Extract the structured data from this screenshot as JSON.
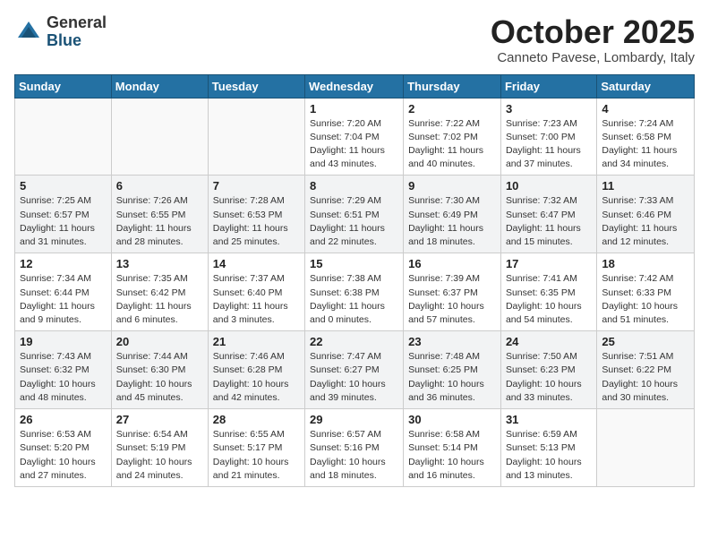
{
  "header": {
    "logo_general": "General",
    "logo_blue": "Blue",
    "month": "October 2025",
    "location": "Canneto Pavese, Lombardy, Italy"
  },
  "weekdays": [
    "Sunday",
    "Monday",
    "Tuesday",
    "Wednesday",
    "Thursday",
    "Friday",
    "Saturday"
  ],
  "weeks": [
    [
      {
        "day": "",
        "info": ""
      },
      {
        "day": "",
        "info": ""
      },
      {
        "day": "",
        "info": ""
      },
      {
        "day": "1",
        "info": "Sunrise: 7:20 AM\nSunset: 7:04 PM\nDaylight: 11 hours and 43 minutes."
      },
      {
        "day": "2",
        "info": "Sunrise: 7:22 AM\nSunset: 7:02 PM\nDaylight: 11 hours and 40 minutes."
      },
      {
        "day": "3",
        "info": "Sunrise: 7:23 AM\nSunset: 7:00 PM\nDaylight: 11 hours and 37 minutes."
      },
      {
        "day": "4",
        "info": "Sunrise: 7:24 AM\nSunset: 6:58 PM\nDaylight: 11 hours and 34 minutes."
      }
    ],
    [
      {
        "day": "5",
        "info": "Sunrise: 7:25 AM\nSunset: 6:57 PM\nDaylight: 11 hours and 31 minutes."
      },
      {
        "day": "6",
        "info": "Sunrise: 7:26 AM\nSunset: 6:55 PM\nDaylight: 11 hours and 28 minutes."
      },
      {
        "day": "7",
        "info": "Sunrise: 7:28 AM\nSunset: 6:53 PM\nDaylight: 11 hours and 25 minutes."
      },
      {
        "day": "8",
        "info": "Sunrise: 7:29 AM\nSunset: 6:51 PM\nDaylight: 11 hours and 22 minutes."
      },
      {
        "day": "9",
        "info": "Sunrise: 7:30 AM\nSunset: 6:49 PM\nDaylight: 11 hours and 18 minutes."
      },
      {
        "day": "10",
        "info": "Sunrise: 7:32 AM\nSunset: 6:47 PM\nDaylight: 11 hours and 15 minutes."
      },
      {
        "day": "11",
        "info": "Sunrise: 7:33 AM\nSunset: 6:46 PM\nDaylight: 11 hours and 12 minutes."
      }
    ],
    [
      {
        "day": "12",
        "info": "Sunrise: 7:34 AM\nSunset: 6:44 PM\nDaylight: 11 hours and 9 minutes."
      },
      {
        "day": "13",
        "info": "Sunrise: 7:35 AM\nSunset: 6:42 PM\nDaylight: 11 hours and 6 minutes."
      },
      {
        "day": "14",
        "info": "Sunrise: 7:37 AM\nSunset: 6:40 PM\nDaylight: 11 hours and 3 minutes."
      },
      {
        "day": "15",
        "info": "Sunrise: 7:38 AM\nSunset: 6:38 PM\nDaylight: 11 hours and 0 minutes."
      },
      {
        "day": "16",
        "info": "Sunrise: 7:39 AM\nSunset: 6:37 PM\nDaylight: 10 hours and 57 minutes."
      },
      {
        "day": "17",
        "info": "Sunrise: 7:41 AM\nSunset: 6:35 PM\nDaylight: 10 hours and 54 minutes."
      },
      {
        "day": "18",
        "info": "Sunrise: 7:42 AM\nSunset: 6:33 PM\nDaylight: 10 hours and 51 minutes."
      }
    ],
    [
      {
        "day": "19",
        "info": "Sunrise: 7:43 AM\nSunset: 6:32 PM\nDaylight: 10 hours and 48 minutes."
      },
      {
        "day": "20",
        "info": "Sunrise: 7:44 AM\nSunset: 6:30 PM\nDaylight: 10 hours and 45 minutes."
      },
      {
        "day": "21",
        "info": "Sunrise: 7:46 AM\nSunset: 6:28 PM\nDaylight: 10 hours and 42 minutes."
      },
      {
        "day": "22",
        "info": "Sunrise: 7:47 AM\nSunset: 6:27 PM\nDaylight: 10 hours and 39 minutes."
      },
      {
        "day": "23",
        "info": "Sunrise: 7:48 AM\nSunset: 6:25 PM\nDaylight: 10 hours and 36 minutes."
      },
      {
        "day": "24",
        "info": "Sunrise: 7:50 AM\nSunset: 6:23 PM\nDaylight: 10 hours and 33 minutes."
      },
      {
        "day": "25",
        "info": "Sunrise: 7:51 AM\nSunset: 6:22 PM\nDaylight: 10 hours and 30 minutes."
      }
    ],
    [
      {
        "day": "26",
        "info": "Sunrise: 6:53 AM\nSunset: 5:20 PM\nDaylight: 10 hours and 27 minutes."
      },
      {
        "day": "27",
        "info": "Sunrise: 6:54 AM\nSunset: 5:19 PM\nDaylight: 10 hours and 24 minutes."
      },
      {
        "day": "28",
        "info": "Sunrise: 6:55 AM\nSunset: 5:17 PM\nDaylight: 10 hours and 21 minutes."
      },
      {
        "day": "29",
        "info": "Sunrise: 6:57 AM\nSunset: 5:16 PM\nDaylight: 10 hours and 18 minutes."
      },
      {
        "day": "30",
        "info": "Sunrise: 6:58 AM\nSunset: 5:14 PM\nDaylight: 10 hours and 16 minutes."
      },
      {
        "day": "31",
        "info": "Sunrise: 6:59 AM\nSunset: 5:13 PM\nDaylight: 10 hours and 13 minutes."
      },
      {
        "day": "",
        "info": ""
      }
    ]
  ]
}
